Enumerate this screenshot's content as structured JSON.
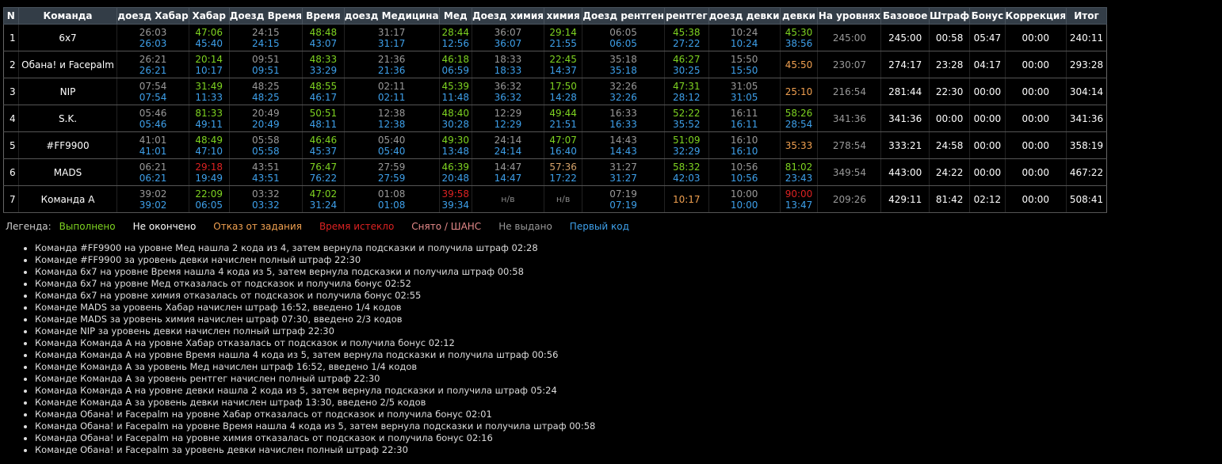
{
  "headers": [
    "N",
    "Команда",
    "доезд Хабар",
    "Хабар",
    "Доезд Время",
    "Время",
    "доезд Медицина",
    "Мед",
    "Доезд химия",
    "химия",
    "Доезд рентген",
    "рентгег",
    "доезд девки",
    "девки",
    "На уровнях",
    "Базовое",
    "Штраф",
    "Бонус",
    "Коррекция",
    "Итог"
  ],
  "rows": [
    {
      "n": "1",
      "team": "6x7",
      "cells": [
        {
          "top": "26:03",
          "tc": "grey",
          "bot": "26:03",
          "bc": "blue"
        },
        {
          "top": "47:06",
          "tc": "green",
          "bot": "45:40",
          "bc": "blue"
        },
        {
          "top": "24:15",
          "tc": "grey",
          "bot": "24:15",
          "bc": "blue"
        },
        {
          "top": "48:48",
          "tc": "green",
          "bot": "43:07",
          "bc": "blue"
        },
        {
          "top": "31:17",
          "tc": "grey",
          "bot": "31:17",
          "bc": "blue"
        },
        {
          "top": "28:44",
          "tc": "green",
          "bot": "12:56",
          "bc": "blue"
        },
        {
          "top": "36:07",
          "tc": "grey",
          "bot": "36:07",
          "bc": "blue"
        },
        {
          "top": "29:14",
          "tc": "green",
          "bot": "21:55",
          "bc": "blue"
        },
        {
          "top": "06:05",
          "tc": "grey",
          "bot": "06:05",
          "bc": "blue"
        },
        {
          "top": "45:38",
          "tc": "green",
          "bot": "27:22",
          "bc": "blue"
        },
        {
          "top": "10:24",
          "tc": "grey",
          "bot": "10:24",
          "bc": "blue"
        },
        {
          "top": "45:30",
          "tc": "green",
          "bot": "38:56",
          "bc": "blue"
        }
      ],
      "levels": "245:00",
      "base": "245:00",
      "penalty": "00:58",
      "bonus": "05:47",
      "corr": "00:00",
      "total": "240:11"
    },
    {
      "n": "2",
      "team": "Обана! и Facepalm",
      "cells": [
        {
          "top": "26:21",
          "tc": "grey",
          "bot": "26:21",
          "bc": "blue"
        },
        {
          "top": "20:14",
          "tc": "green",
          "bot": "10:17",
          "bc": "blue"
        },
        {
          "top": "09:51",
          "tc": "grey",
          "bot": "09:51",
          "bc": "blue"
        },
        {
          "top": "48:33",
          "tc": "green",
          "bot": "33:29",
          "bc": "blue"
        },
        {
          "top": "21:36",
          "tc": "grey",
          "bot": "21:36",
          "bc": "blue"
        },
        {
          "top": "46:18",
          "tc": "green",
          "bot": "06:59",
          "bc": "blue"
        },
        {
          "top": "18:33",
          "tc": "grey",
          "bot": "18:33",
          "bc": "blue"
        },
        {
          "top": "22:45",
          "tc": "green",
          "bot": "14:37",
          "bc": "blue"
        },
        {
          "top": "35:18",
          "tc": "grey",
          "bot": "35:18",
          "bc": "blue"
        },
        {
          "top": "46:27",
          "tc": "green",
          "bot": "30:25",
          "bc": "blue"
        },
        {
          "top": "15:50",
          "tc": "grey",
          "bot": "15:50",
          "bc": "blue"
        },
        {
          "top": "45:50",
          "tc": "orange",
          "bot": "",
          "bc": "blue"
        }
      ],
      "levels": "230:07",
      "base": "274:17",
      "penalty": "23:28",
      "bonus": "04:17",
      "corr": "00:00",
      "total": "293:28"
    },
    {
      "n": "3",
      "team": "NIP",
      "cells": [
        {
          "top": "07:54",
          "tc": "grey",
          "bot": "07:54",
          "bc": "blue"
        },
        {
          "top": "31:49",
          "tc": "green",
          "bot": "11:33",
          "bc": "blue"
        },
        {
          "top": "48:25",
          "tc": "grey",
          "bot": "48:25",
          "bc": "blue"
        },
        {
          "top": "48:55",
          "tc": "green",
          "bot": "46:17",
          "bc": "blue"
        },
        {
          "top": "02:11",
          "tc": "grey",
          "bot": "02:11",
          "bc": "blue"
        },
        {
          "top": "45:39",
          "tc": "green",
          "bot": "11:48",
          "bc": "blue"
        },
        {
          "top": "36:32",
          "tc": "grey",
          "bot": "36:32",
          "bc": "blue"
        },
        {
          "top": "17:50",
          "tc": "green",
          "bot": "14:28",
          "bc": "blue"
        },
        {
          "top": "32:26",
          "tc": "grey",
          "bot": "32:26",
          "bc": "blue"
        },
        {
          "top": "47:31",
          "tc": "green",
          "bot": "28:12",
          "bc": "blue"
        },
        {
          "top": "31:05",
          "tc": "grey",
          "bot": "31:05",
          "bc": "blue"
        },
        {
          "top": "25:10",
          "tc": "orange",
          "bot": "",
          "bc": "blue"
        }
      ],
      "levels": "216:54",
      "base": "281:44",
      "penalty": "22:30",
      "bonus": "00:00",
      "corr": "00:00",
      "total": "304:14"
    },
    {
      "n": "4",
      "team": "S.K.",
      "cells": [
        {
          "top": "05:46",
          "tc": "grey",
          "bot": "05:46",
          "bc": "blue"
        },
        {
          "top": "81:33",
          "tc": "green",
          "bot": "49:11",
          "bc": "blue"
        },
        {
          "top": "20:49",
          "tc": "grey",
          "bot": "20:49",
          "bc": "blue"
        },
        {
          "top": "50:51",
          "tc": "green",
          "bot": "48:11",
          "bc": "blue"
        },
        {
          "top": "12:38",
          "tc": "grey",
          "bot": "12:38",
          "bc": "blue"
        },
        {
          "top": "48:40",
          "tc": "green",
          "bot": "30:28",
          "bc": "blue"
        },
        {
          "top": "12:29",
          "tc": "grey",
          "bot": "12:29",
          "bc": "blue"
        },
        {
          "top": "49:44",
          "tc": "green",
          "bot": "21:51",
          "bc": "blue"
        },
        {
          "top": "16:33",
          "tc": "grey",
          "bot": "16:33",
          "bc": "blue"
        },
        {
          "top": "52:22",
          "tc": "green",
          "bot": "35:52",
          "bc": "blue"
        },
        {
          "top": "16:11",
          "tc": "grey",
          "bot": "16:11",
          "bc": "blue"
        },
        {
          "top": "58:26",
          "tc": "green",
          "bot": "28:54",
          "bc": "blue"
        }
      ],
      "levels": "341:36",
      "base": "341:36",
      "penalty": "00:00",
      "bonus": "00:00",
      "corr": "00:00",
      "total": "341:36"
    },
    {
      "n": "5",
      "team": "#FF9900",
      "cells": [
        {
          "top": "41:01",
          "tc": "grey",
          "bot": "41:01",
          "bc": "blue"
        },
        {
          "top": "48:49",
          "tc": "green",
          "bot": "47:10",
          "bc": "blue"
        },
        {
          "top": "05:58",
          "tc": "grey",
          "bot": "05:58",
          "bc": "blue"
        },
        {
          "top": "46:46",
          "tc": "green",
          "bot": "45:37",
          "bc": "blue"
        },
        {
          "top": "05:40",
          "tc": "grey",
          "bot": "05:40",
          "bc": "blue"
        },
        {
          "top": "49:30",
          "tc": "green",
          "bot": "13:48",
          "bc": "blue"
        },
        {
          "top": "24:14",
          "tc": "grey",
          "bot": "24:14",
          "bc": "blue"
        },
        {
          "top": "47:07",
          "tc": "green",
          "bot": "16:40",
          "bc": "blue"
        },
        {
          "top": "14:43",
          "tc": "grey",
          "bot": "14:43",
          "bc": "blue"
        },
        {
          "top": "51:09",
          "tc": "green",
          "bot": "32:29",
          "bc": "blue"
        },
        {
          "top": "16:10",
          "tc": "grey",
          "bot": "16:10",
          "bc": "blue"
        },
        {
          "top": "35:33",
          "tc": "orange",
          "bot": "",
          "bc": "blue"
        }
      ],
      "levels": "278:54",
      "base": "333:21",
      "penalty": "24:58",
      "bonus": "00:00",
      "corr": "00:00",
      "total": "358:19"
    },
    {
      "n": "6",
      "team": "MADS",
      "cells": [
        {
          "top": "06:21",
          "tc": "grey",
          "bot": "06:21",
          "bc": "blue"
        },
        {
          "top": "29:18",
          "tc": "red",
          "bot": "19:49",
          "bc": "blue"
        },
        {
          "top": "43:51",
          "tc": "grey",
          "bot": "43:51",
          "bc": "blue"
        },
        {
          "top": "76:47",
          "tc": "green",
          "bot": "76:22",
          "bc": "blue"
        },
        {
          "top": "27:59",
          "tc": "grey",
          "bot": "27:59",
          "bc": "blue"
        },
        {
          "top": "46:39",
          "tc": "green",
          "bot": "20:48",
          "bc": "blue"
        },
        {
          "top": "14:47",
          "tc": "grey",
          "bot": "14:47",
          "bc": "blue"
        },
        {
          "top": "57:36",
          "tc": "sand",
          "bot": "17:22",
          "bc": "blue"
        },
        {
          "top": "31:27",
          "tc": "grey",
          "bot": "31:27",
          "bc": "blue"
        },
        {
          "top": "58:32",
          "tc": "green",
          "bot": "42:03",
          "bc": "blue"
        },
        {
          "top": "10:56",
          "tc": "grey",
          "bot": "10:56",
          "bc": "blue"
        },
        {
          "top": "81:02",
          "tc": "green",
          "bot": "23:43",
          "bc": "blue"
        }
      ],
      "levels": "349:54",
      "base": "443:00",
      "penalty": "24:22",
      "bonus": "00:00",
      "corr": "00:00",
      "total": "467:22"
    },
    {
      "n": "7",
      "team": "Команда А",
      "cells": [
        {
          "top": "39:02",
          "tc": "grey",
          "bot": "39:02",
          "bc": "blue"
        },
        {
          "top": "22:09",
          "tc": "green",
          "bot": "06:05",
          "bc": "blue"
        },
        {
          "top": "03:32",
          "tc": "grey",
          "bot": "03:32",
          "bc": "blue"
        },
        {
          "top": "47:02",
          "tc": "green",
          "bot": "31:24",
          "bc": "blue"
        },
        {
          "top": "01:08",
          "tc": "grey",
          "bot": "01:08",
          "bc": "blue"
        },
        {
          "top": "39:58",
          "tc": "red",
          "bot": "39:34",
          "bc": "blue"
        },
        {
          "top": "н/в",
          "tc": "dim",
          "bot": "",
          "bc": "blue"
        },
        {
          "top": "н/в",
          "tc": "dim",
          "bot": "",
          "bc": "blue"
        },
        {
          "top": "07:19",
          "tc": "grey",
          "bot": "07:19",
          "bc": "blue"
        },
        {
          "top": "10:17",
          "tc": "orange",
          "bot": "",
          "bc": "blue"
        },
        {
          "top": "10:00",
          "tc": "grey",
          "bot": "10:00",
          "bc": "blue"
        },
        {
          "top": "90:00",
          "tc": "red",
          "bot": "13:47",
          "bc": "blue"
        }
      ],
      "levels": "209:26",
      "base": "429:11",
      "penalty": "81:42",
      "bonus": "02:12",
      "corr": "00:00",
      "total": "508:41"
    }
  ],
  "legend": {
    "title": "Легенда:",
    "items": [
      {
        "label": "Выполнено",
        "color": "#7ed321"
      },
      {
        "label": "Не окончено",
        "color": "#ffffff"
      },
      {
        "label": "Отказ от задания",
        "color": "#f0a050"
      },
      {
        "label": "Время истекло",
        "color": "#dd2222"
      },
      {
        "label": "Снято / ШАНС",
        "color": "#e58a8a"
      },
      {
        "label": "Не выдано",
        "color": "#999999"
      },
      {
        "label": "Первый код",
        "color": "#3ea0ea"
      }
    ]
  },
  "log": [
    "Команда #FF9900 на уровне Мед нашла 2 кода из 4, затем вернула подсказки и получила штраф 02:28",
    "Команде #FF9900 за уровень девки начислен полный штраф 22:30",
    "Команда 6x7 на уровне Время нашла 4 кода из 5, затем вернула подсказки и получила штраф 00:58",
    "Команда 6x7 на уровне Мед отказалась от подсказок и получила бонус 02:52",
    "Команда 6x7 на уровне химия отказалась от подсказок и получила бонус 02:55",
    "Команде MADS за уровень Хабар начислен штраф 16:52, введено 1/4 кодов",
    "Команде MADS за уровень химия начислен штраф 07:30, введено 2/3 кодов",
    "Команде NIP за уровень девки начислен полный штраф 22:30",
    "Команда Команда А на уровне Хабар отказалась от подсказок и получила бонус 02:12",
    "Команда Команда А на уровне Время нашла 4 кода из 5, затем вернула подсказки и получила штраф 00:56",
    "Команде Команда А за уровень Мед начислен штраф 16:52, введено 1/4 кодов",
    "Команде Команда А за уровень рентгег начислен полный штраф 22:30",
    "Команда Команда А на уровне девки нашла 2 кода из 5, затем вернула подсказки и получила штраф 05:24",
    "Команде Команда А за уровень девки начислен штраф 13:30, введено 2/5 кодов",
    "Команда Обана! и Facepalm на уровне Хабар отказалась от подсказок и получила бонус 02:01",
    "Команда Обана! и Facepalm на уровне Время нашла 4 кода из 5, затем вернула подсказки и получила штраф 00:58",
    "Команда Обана! и Facepalm на уровне химия отказалась от подсказок и получила бонус 02:16",
    "Команде Обана! и Facepalm за уровень девки начислен полный штраф 22:30"
  ]
}
